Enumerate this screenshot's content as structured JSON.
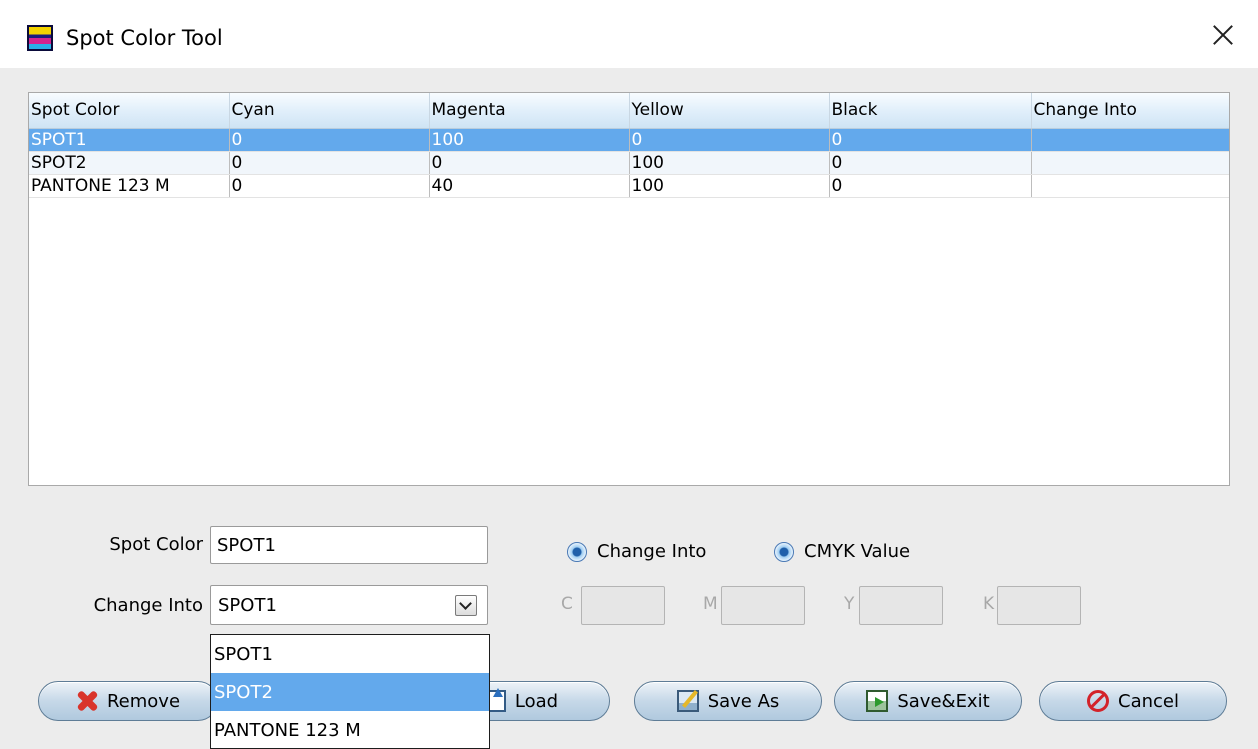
{
  "window": {
    "title": "Spot Color Tool"
  },
  "table": {
    "columns": [
      "Spot Color",
      "Cyan",
      "Magenta",
      "Yellow",
      "Black",
      "Change Into"
    ],
    "rows": [
      [
        "SPOT1",
        "0",
        "100",
        "0",
        "0",
        ""
      ],
      [
        "SPOT2",
        "0",
        "0",
        "100",
        "0",
        ""
      ],
      [
        "PANTONE 123 M",
        "0",
        "40",
        "100",
        "0",
        ""
      ]
    ],
    "selected_row": 0
  },
  "form": {
    "spot_color_label": "Spot Color",
    "spot_color_value": "SPOT1",
    "change_into_label": "Change Into",
    "change_into_value": "SPOT1",
    "radio_change_into": "Change Into",
    "radio_cmyk": "CMYK Value",
    "cmyk_labels": {
      "c": "C",
      "m": "M",
      "y": "Y",
      "k": "K"
    }
  },
  "dropdown": {
    "options": [
      "SPOT1",
      "SPOT2",
      "PANTONE 123 M"
    ],
    "highlighted": 1
  },
  "buttons": {
    "remove": "Remove",
    "load": "Load",
    "save_as": "Save As",
    "save_exit": "Save&Exit",
    "cancel": "Cancel"
  },
  "colors": {
    "selection": "#63a9ec",
    "header_gradient": "#dfeefa",
    "dialog_background": "#ececec"
  }
}
